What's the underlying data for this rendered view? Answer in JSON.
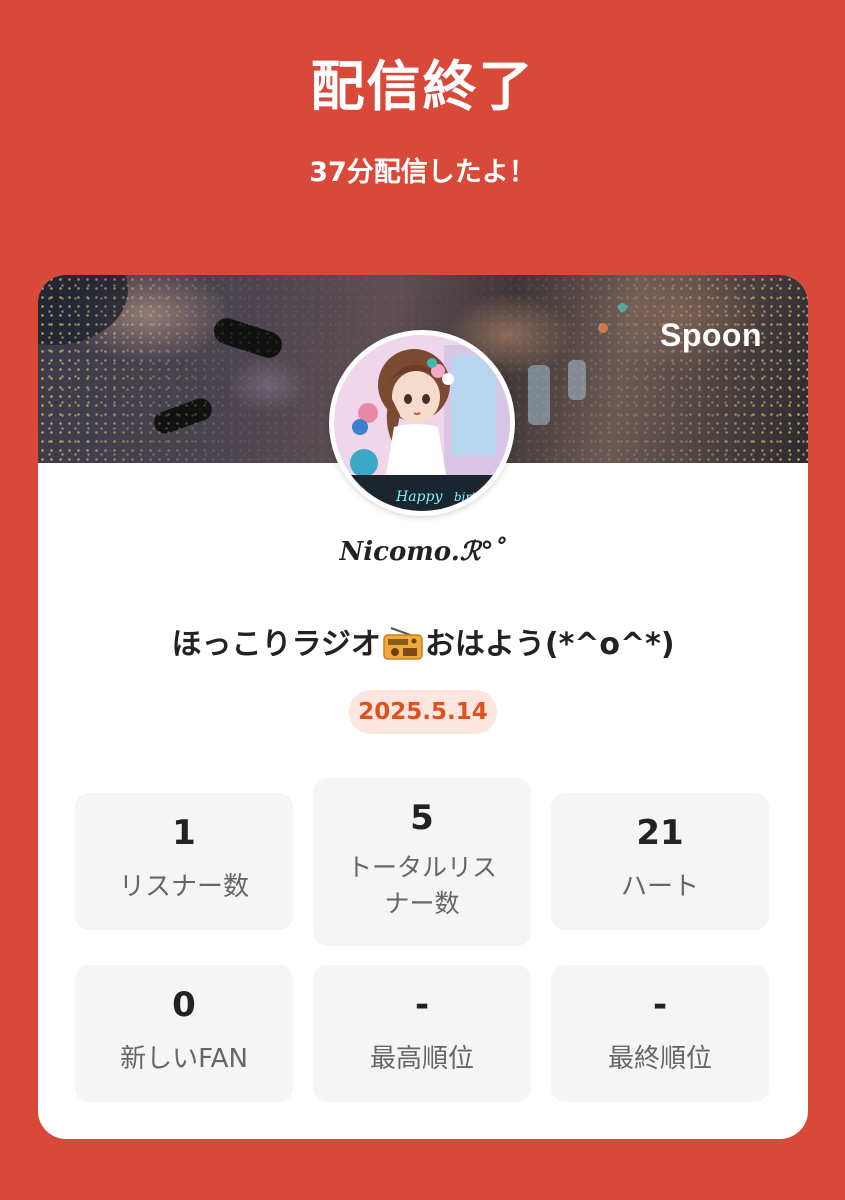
{
  "header": {
    "title": "配信終了",
    "subtitle": "37分配信したよ！"
  },
  "card": {
    "brand": "Spoon",
    "username": "Nicomo.ℛ°˚",
    "stream_title_before": "ほっこりラジオ",
    "stream_title_after": "おはよう(*^o^*)",
    "title_emoji_icon": "radio-icon",
    "date": "2025.5.14",
    "accent_color": "#e0501e",
    "background_color": "#d9493a"
  },
  "stats": [
    {
      "value": "1",
      "label": "リスナー数"
    },
    {
      "value": "5",
      "label_line1": "トータルリス",
      "label_line2": "ナー数"
    },
    {
      "value": "21",
      "label": "ハート"
    },
    {
      "value": "0",
      "label": "新しいFAN"
    },
    {
      "value": "-",
      "label": "最高順位"
    },
    {
      "value": "-",
      "label": "最終順位"
    }
  ]
}
